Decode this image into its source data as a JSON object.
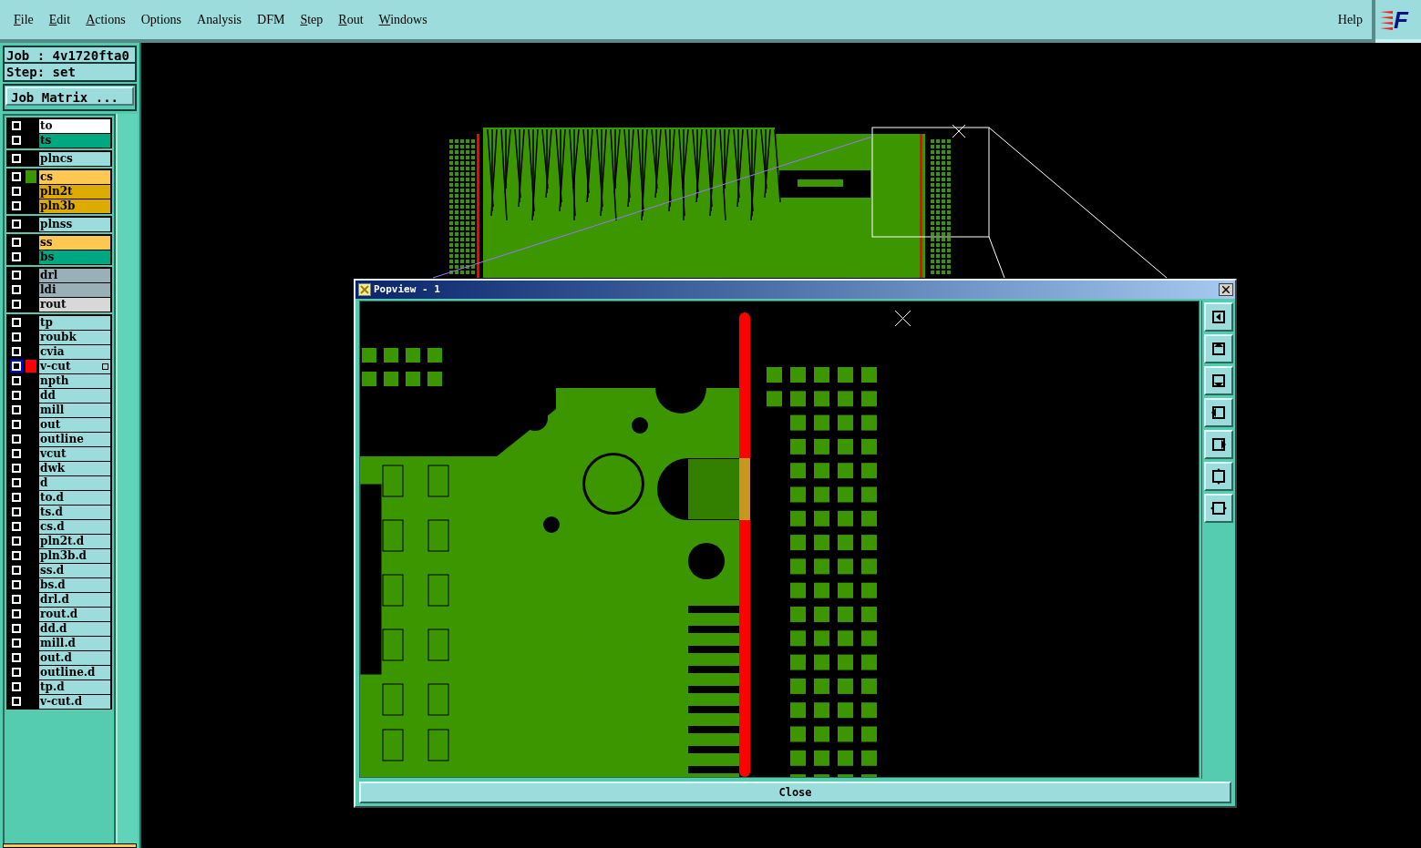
{
  "menu": [
    {
      "label": "File",
      "mnemonic": true
    },
    {
      "label": "Edit",
      "mnemonic": true
    },
    {
      "label": "Actions",
      "mnemonic": true
    },
    {
      "label": "Options",
      "mnemonic": false
    },
    {
      "label": "Analysis",
      "mnemonic": false
    },
    {
      "label": "DFM",
      "mnemonic": false
    },
    {
      "label": "Step",
      "mnemonic": true
    },
    {
      "label": "Rout",
      "mnemonic": true
    },
    {
      "label": "Windows",
      "mnemonic": true
    }
  ],
  "help": "Help",
  "logo": "F",
  "job": "Job : 4v1720fta0",
  "step": "Step: set",
  "job_matrix": "Job Matrix ...",
  "layer_groups": [
    [
      {
        "name": "to",
        "color": "#ffffff",
        "selected": false
      },
      {
        "name": "ts",
        "color": "#00a882",
        "selected": false
      }
    ],
    [
      {
        "name": "plncs",
        "color": "#9ddcdc",
        "selected": false
      }
    ],
    [
      {
        "name": "cs",
        "color": "#ffc850",
        "swatch": {
          "color": "#3c9600"
        },
        "selected": false
      },
      {
        "name": "pln2t",
        "color": "#dcaa00",
        "selected": false
      },
      {
        "name": "pln3b",
        "color": "#dcaa00",
        "selected": false
      }
    ],
    [
      {
        "name": "plnss",
        "color": "#9ddcdc",
        "selected": false
      }
    ],
    [
      {
        "name": "ss",
        "color": "#ffc850",
        "selected": false
      },
      {
        "name": "bs",
        "color": "#00a882",
        "selected": false
      }
    ],
    [
      {
        "name": "drl",
        "color": "#9ab0b8",
        "selected": false
      },
      {
        "name": "ldi",
        "color": "#9ab0b8",
        "selected": false
      },
      {
        "name": "rout",
        "color": "#d8d8d8",
        "selected": false
      }
    ],
    [
      {
        "name": "tp",
        "color": "#9ddcdc",
        "selected": false
      },
      {
        "name": "roubk",
        "color": "#9ddcdc",
        "selected": false
      },
      {
        "name": "cvia",
        "color": "#9ddcdc",
        "selected": false
      },
      {
        "name": "v-cut",
        "color": "#9ddcdc",
        "swatch": {
          "color": "#ff0000"
        },
        "selected": true,
        "extra": true
      },
      {
        "name": "npth",
        "color": "#9ddcdc",
        "selected": false
      },
      {
        "name": "dd",
        "color": "#9ddcdc",
        "selected": false
      },
      {
        "name": "mill",
        "color": "#9ddcdc",
        "selected": false
      },
      {
        "name": "out",
        "color": "#9ddcdc",
        "selected": false
      },
      {
        "name": "outline",
        "color": "#9ddcdc",
        "selected": false
      },
      {
        "name": "vcut",
        "color": "#9ddcdc",
        "selected": false
      },
      {
        "name": "dwk",
        "color": "#9ddcdc",
        "selected": false
      },
      {
        "name": "d",
        "color": "#9ddcdc",
        "selected": false
      },
      {
        "name": "to.d",
        "color": "#9ddcdc",
        "selected": false
      },
      {
        "name": "ts.d",
        "color": "#9ddcdc",
        "selected": false
      },
      {
        "name": "cs.d",
        "color": "#9ddcdc",
        "selected": false
      },
      {
        "name": "pln2t.d",
        "color": "#9ddcdc",
        "selected": false
      },
      {
        "name": "pln3b.d",
        "color": "#9ddcdc",
        "selected": false
      },
      {
        "name": "ss.d",
        "color": "#9ddcdc",
        "selected": false
      },
      {
        "name": "bs.d",
        "color": "#9ddcdc",
        "selected": false
      },
      {
        "name": "drl.d",
        "color": "#9ddcdc",
        "selected": false
      },
      {
        "name": "rout.d",
        "color": "#9ddcdc",
        "selected": false
      },
      {
        "name": "dd.d",
        "color": "#9ddcdc",
        "selected": false
      },
      {
        "name": "mill.d",
        "color": "#9ddcdc",
        "selected": false
      },
      {
        "name": "out.d",
        "color": "#9ddcdc",
        "selected": false
      },
      {
        "name": "outline.d",
        "color": "#9ddcdc",
        "selected": false
      },
      {
        "name": "tp.d",
        "color": "#9ddcdc",
        "selected": false
      },
      {
        "name": "v-cut.d",
        "color": "#9ddcdc",
        "selected": false
      }
    ]
  ],
  "popview": {
    "title": "Popview - 1",
    "close": "Close"
  }
}
